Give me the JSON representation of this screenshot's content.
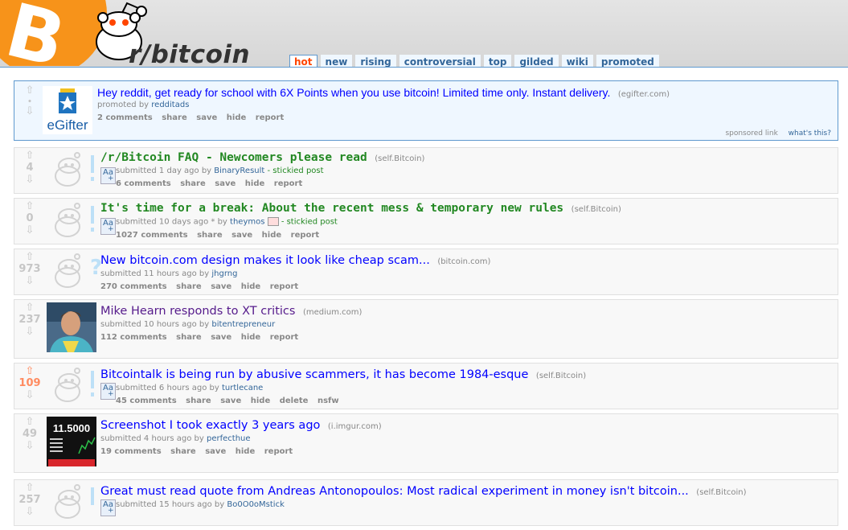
{
  "header": {
    "subreddit": "r/bitcoin",
    "tabs": [
      "hot",
      "new",
      "rising",
      "controversial",
      "top",
      "gilded",
      "wiki",
      "promoted"
    ],
    "selected_tab": "hot"
  },
  "promoted": {
    "thumb_text": "eGifter",
    "title": "Hey reddit, get ready for school with 6X Points when you use bitcoin! Limited time only. Instant delivery.",
    "domain": "(egifter.com)",
    "promoted_by_prefix": "promoted by",
    "promoted_by": "redditads",
    "buttons": [
      "2 comments",
      "share",
      "save",
      "hide",
      "report"
    ],
    "sponsored_link": "sponsored link",
    "whats_this": "what's this?",
    "vote_dot": "•"
  },
  "posts": [
    {
      "score": "4",
      "title": "/r/Bitcoin FAQ - Newcomers please read",
      "domain": "(self.Bitcoin)",
      "tagline_prefix": "submitted 1 day ago by",
      "author": "BinaryResult",
      "extra": "- stickied post",
      "buttons": [
        "6 comments",
        "share",
        "save",
        "hide",
        "report"
      ]
    },
    {
      "score": "0",
      "title": "It's time for a break: About the recent mess & temporary new rules",
      "domain": "(self.Bitcoin)",
      "tagline_prefix": "submitted 10 days ago * by",
      "author": "theymos",
      "extra": "- stickied post",
      "buttons": [
        "1027 comments",
        "share",
        "save",
        "hide",
        "report"
      ]
    },
    {
      "score": "973",
      "title": "New bitcoin.com design makes it look like cheap scam...",
      "domain": "(bitcoin.com)",
      "tagline_prefix": "submitted 11 hours ago by",
      "author": "jhgrng",
      "buttons": [
        "270 comments",
        "share",
        "save",
        "hide",
        "report"
      ]
    },
    {
      "score": "237",
      "title": "Mike Hearn responds to XT critics",
      "domain": "(medium.com)",
      "tagline_prefix": "submitted 10 hours ago by",
      "author": "bitentrepreneur",
      "buttons": [
        "112 comments",
        "share",
        "save",
        "hide",
        "report"
      ]
    },
    {
      "score": "109",
      "title": "Bitcointalk is being run by abusive scammers, it has become 1984-esque",
      "domain": "(self.Bitcoin)",
      "tagline_prefix": "submitted 6 hours ago by",
      "author": "turtlecane",
      "buttons": [
        "45 comments",
        "share",
        "save",
        "hide",
        "delete",
        "nsfw"
      ]
    },
    {
      "score": "49",
      "title": "Screenshot I took exactly 3 years ago",
      "domain": "(i.imgur.com)",
      "tagline_prefix": "submitted 4 hours ago by",
      "author": "perfecthue",
      "thumb_text": "11.5000",
      "buttons": [
        "19 comments",
        "share",
        "save",
        "hide",
        "report"
      ]
    },
    {
      "score": "257",
      "title": "Great must read quote from Andreas Antonopoulos: Most radical experiment in money isn't bitcoin...",
      "domain": "(self.Bitcoin)",
      "tagline_prefix": "submitted 15 hours ago by",
      "author": "Bo0O0oMstick",
      "buttons": []
    }
  ],
  "colors": {
    "link": "#0000ff",
    "stickied": "#228822",
    "upvoted": "#ff8b60",
    "tab_selected": "#ff4500",
    "btc_orange": "#f7931a"
  }
}
